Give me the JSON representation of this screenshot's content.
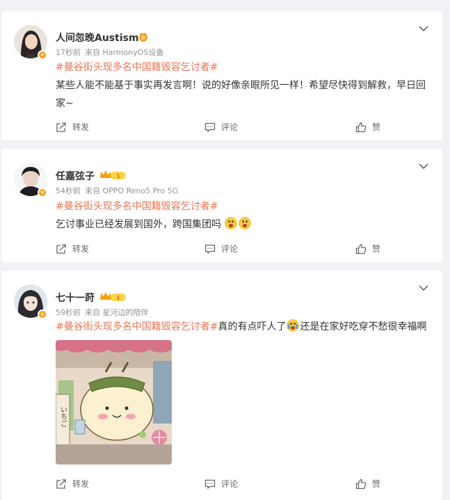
{
  "posts": [
    {
      "user": "人间忽晚Austism",
      "time": "17秒前",
      "source": "来自 HarmonyOS设备",
      "topic": "#曼谷街头现多名中国籍毁容乞讨者#",
      "text": "某些人能不能基于事实再发言啊！说的好像亲眼所见一样！希望尽快得到解救，早日回家~",
      "actions": {
        "repost": "转发",
        "comment": "评论",
        "like": "赞"
      }
    },
    {
      "user": "任嘉弦子",
      "time": "54秒前",
      "source": "来自 OPPO Reno5 Pro 5G",
      "topic": "#曼谷街头现多名中国籍毁容乞讨者#",
      "text": "乞讨事业已经发展到国外，跨国集团吗",
      "actions": {
        "repost": "转发",
        "comment": "评论",
        "like": "赞"
      }
    },
    {
      "user": "七十一莳",
      "time": "59秒前",
      "source": "来自 星河边的陪伴",
      "topic": "#曼谷街头现多名中国籍毁容乞讨者#",
      "text_a": "真的有点吓人了",
      "text_b": "还是在家好吃穿不愁很幸福啊",
      "image_sign": "いちご",
      "actions": {
        "repost": "转发",
        "comment": "评论",
        "like": "赞"
      }
    }
  ],
  "icons": {
    "repost": "share-icon",
    "comment": "comment-icon",
    "like": "thumbs-up-icon",
    "more": "chevron-down-icon",
    "verified": "verified-badge-icon",
    "vip": "crown-icon"
  },
  "colors": {
    "topic": "#eb7350",
    "meta": "#939393",
    "badge": "#f59d17",
    "background": "#f1f2f5"
  }
}
